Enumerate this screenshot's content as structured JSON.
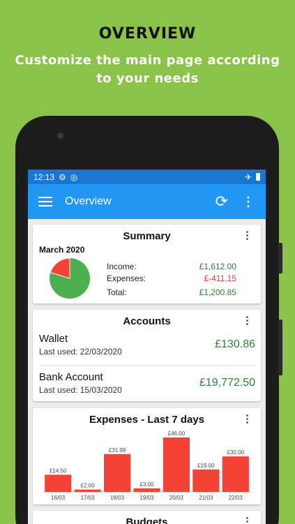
{
  "promo": {
    "title": "OVERVIEW",
    "subtitle": "Customize the main page according to your needs"
  },
  "statusbar": {
    "time": "12:13",
    "icons": [
      "gear-icon",
      "data-saver-icon",
      "airplane-icon",
      "battery-icon"
    ]
  },
  "toolbar": {
    "title": "Overview",
    "icons": [
      "menu-icon",
      "sync-icon",
      "more-vert-icon"
    ]
  },
  "summary": {
    "title": "Summary",
    "month": "March 2020",
    "income_label": "Income:",
    "income_value": "£1,612.00",
    "expenses_label": "Expenses:",
    "expenses_value": "£-411.15",
    "total_label": "Total:",
    "total_value": "£1,200.85",
    "pie_colors": {
      "income": "#4caf50",
      "expenses": "#f44336"
    },
    "pie_values": {
      "income": 1612.0,
      "expenses": 411.15
    }
  },
  "accounts": {
    "title": "Accounts",
    "items": [
      {
        "name": "Wallet",
        "last_used": "Last used: 22/03/2020",
        "balance": "£130.86"
      },
      {
        "name": "Bank Account",
        "last_used": "Last used: 15/03/2020",
        "balance": "£19,772.50"
      }
    ]
  },
  "chart_data": {
    "type": "bar",
    "title": "Expenses - Last 7 days",
    "categories": [
      "16/03",
      "17/03",
      "18/03",
      "19/03",
      "20/03",
      "21/03",
      "22/03"
    ],
    "values": [
      14.5,
      2.0,
      31.99,
      3.0,
      46.0,
      19.0,
      30.0
    ],
    "labels": [
      "£14.50",
      "£2.00",
      "£31.99",
      "£3.00",
      "£46.00",
      "£19.00",
      "£30.00"
    ],
    "ylim": [
      0,
      46
    ],
    "bar_color": "#f44336",
    "grid": false
  },
  "budgets": {
    "title": "Budgets"
  },
  "colors": {
    "background": "#8bc34a",
    "statusbar": "#1976d2",
    "toolbar": "#2196f3",
    "positive": "#2e7d32",
    "negative": "#e53935"
  }
}
